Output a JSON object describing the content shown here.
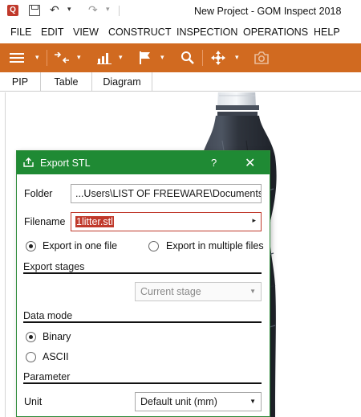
{
  "window": {
    "title": "New Project - GOM Inspect 2018",
    "app_icon_letter": "Q"
  },
  "quick_access": {
    "undo_glyph": "↶",
    "redo_glyph": "↷",
    "dropdown_glyph": "▾"
  },
  "menu": {
    "items": [
      "FILE",
      "EDIT",
      "VIEW",
      "CONSTRUCT",
      "INSPECTION",
      "OPERATIONS",
      "HELP"
    ]
  },
  "toolbar": {
    "accent_color": "#d16a20",
    "icons": [
      "hamburger-menu-icon",
      "align-icon",
      "chart-icon",
      "flag-icon",
      "search-icon",
      "move-icon",
      "camera-icon"
    ]
  },
  "tabs": [
    "PIP",
    "Table",
    "Diagram"
  ],
  "dialog": {
    "title": "Export STL",
    "help_glyph": "?",
    "close_glyph": "✕",
    "header_color": "#1f8a34",
    "folder": {
      "label": "Folder",
      "value": "...Users\\LIST OF FREEWARE\\Documents"
    },
    "filename": {
      "label": "Filename",
      "value": "1litter.stl",
      "arrow": "▸"
    },
    "export_mode": {
      "option_one": "Export in one file",
      "option_multiple": "Export in multiple files",
      "selected": "option_one"
    },
    "export_stages": {
      "heading": "Export stages",
      "value": "Current stage"
    },
    "data_mode": {
      "heading": "Data mode",
      "binary": "Binary",
      "ascii": "ASCII",
      "selected": "binary"
    },
    "parameter": {
      "heading": "Parameter",
      "unit_label": "Unit",
      "unit_value": "Default unit (mm)"
    }
  }
}
